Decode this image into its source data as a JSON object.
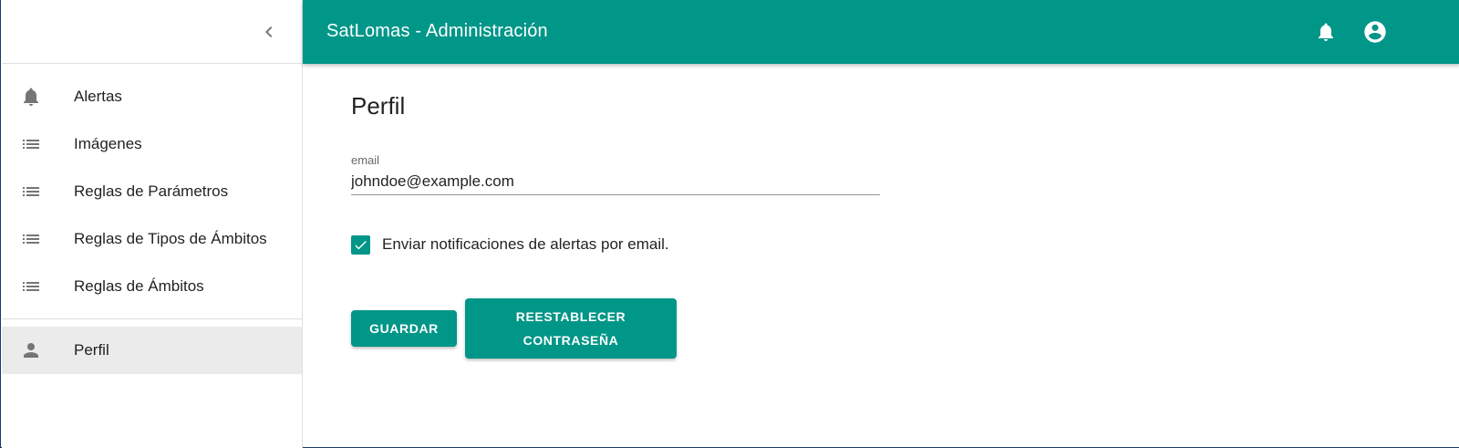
{
  "appbar": {
    "title": "SatLomas - Administración",
    "color": "#009688",
    "icons": [
      "bell-icon",
      "account-circle-icon"
    ]
  },
  "sidebar": {
    "collapse_icon": "chevron-left-icon",
    "items": [
      {
        "label": "Alertas",
        "icon": "bell-icon"
      },
      {
        "label": "Imágenes",
        "icon": "list-icon"
      },
      {
        "label": "Reglas de Parámetros",
        "icon": "list-icon"
      },
      {
        "label": "Reglas de Tipos de Ámbitos",
        "icon": "list-icon"
      },
      {
        "label": "Reglas de Ámbitos",
        "icon": "list-icon"
      }
    ],
    "profile_item": {
      "label": "Perfil",
      "icon": "person-icon",
      "active": true
    }
  },
  "main": {
    "title": "Perfil",
    "email_label": "email",
    "email_value": "johndoe@example.com",
    "notify_label": "Enviar notificaciones de alertas por email.",
    "notify_checked": true,
    "save_label": "GUARDAR",
    "reset_label": "REESTABLECER CONTRASEÑA"
  }
}
